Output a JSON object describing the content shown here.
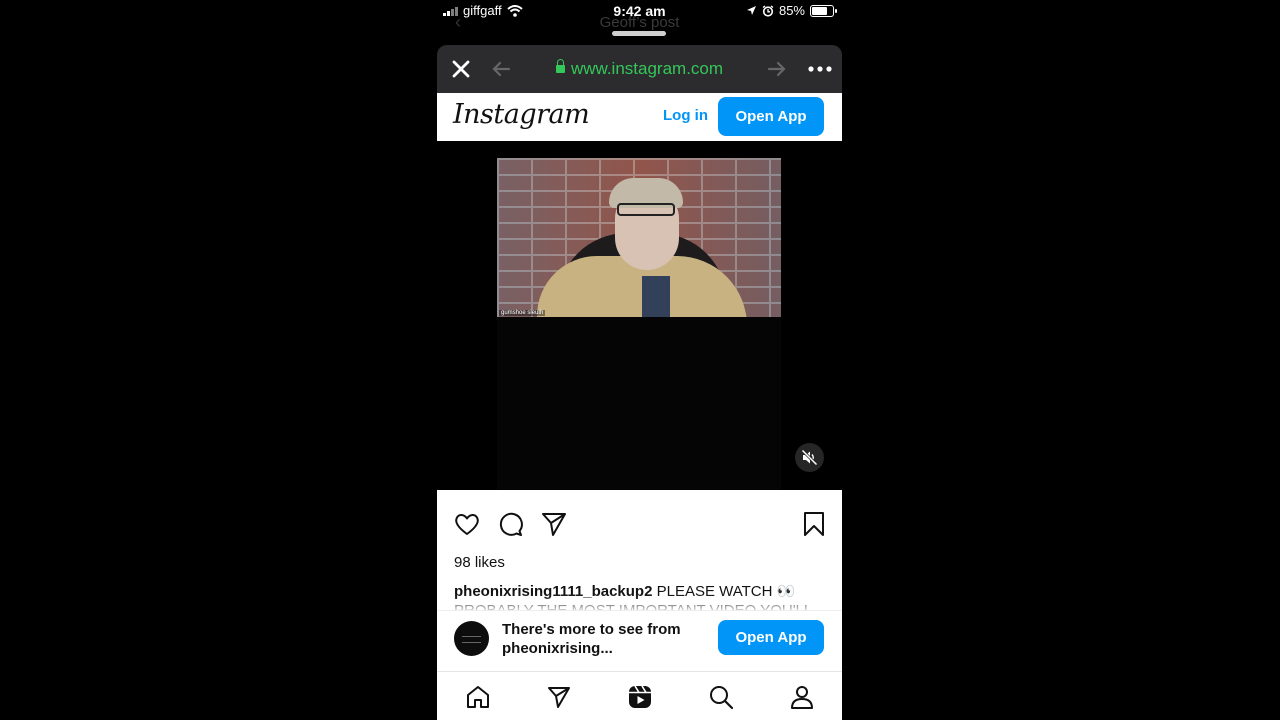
{
  "status_bar": {
    "carrier": "giffgaff",
    "time": "9:42 am",
    "battery": "85%",
    "battery_level": 0.85
  },
  "background_sheet": {
    "title": "Geoff’s post"
  },
  "browser": {
    "url": "www.instagram.com"
  },
  "instagram_header": {
    "logo": "Instagram",
    "login_label": "Log in",
    "open_app_label": "Open App"
  },
  "video": {
    "overlay_label": "gumshoe sleuth"
  },
  "post": {
    "likes": "98 likes",
    "username": "pheonixrising1111_backup2",
    "caption": "PLEASE WATCH 👀 PROBABLY THE MOST IMPORTANT VIDEO YOU'LL"
  },
  "banner": {
    "message": "There's more to see from pheonixrising...",
    "open_app_label": "Open App"
  },
  "bottom_nav": {
    "items": [
      "home-icon",
      "direct-icon",
      "reels-icon",
      "search-icon",
      "profile-icon"
    ]
  }
}
